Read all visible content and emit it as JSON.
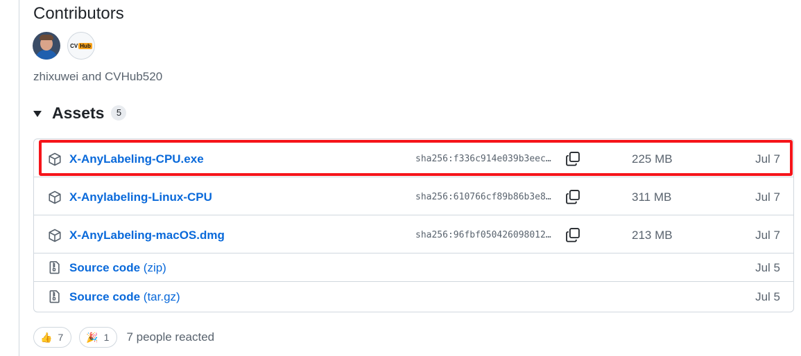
{
  "contributors": {
    "title": "Contributors",
    "avatars": [
      {
        "user": "zhixuwei"
      },
      {
        "user": "CVHub520",
        "logo_text_a": "CV",
        "logo_text_b": "Hub"
      }
    ],
    "names": "zhixuwei and CVHub520"
  },
  "assets": {
    "title": "Assets",
    "count": "5",
    "rows": [
      {
        "name": "X-AnyLabeling-CPU.exe",
        "sha": "sha256:f336c914e039b3eec…",
        "size": "225 MB",
        "date": "Jul 7",
        "icon": "package-icon",
        "highlighted": true
      },
      {
        "name": "X-Anylabeling-Linux-CPU",
        "sha": "sha256:610766cf89b86b3e8…",
        "size": "311 MB",
        "date": "Jul 7",
        "icon": "package-icon"
      },
      {
        "name": "X-AnyLabeling-macOS.dmg",
        "sha": "sha256:96fbf050426098012…",
        "size": "213 MB",
        "date": "Jul 7",
        "icon": "package-icon"
      },
      {
        "name": "Source code",
        "suffix": "(zip)",
        "date": "Jul 5",
        "icon": "file-zip-icon"
      },
      {
        "name": "Source code",
        "suffix": "(tar.gz)",
        "date": "Jul 5",
        "icon": "file-zip-icon"
      }
    ]
  },
  "reactions": {
    "items": [
      {
        "emoji": "👍",
        "icon": "thumbs-up-icon",
        "count": "7"
      },
      {
        "emoji": "🎉",
        "icon": "tada-icon",
        "count": "1"
      }
    ],
    "summary": "7 people reacted"
  },
  "colors": {
    "link": "#0969da",
    "muted": "#59636e",
    "border": "#d0d7de",
    "highlight": "#f5141a"
  }
}
